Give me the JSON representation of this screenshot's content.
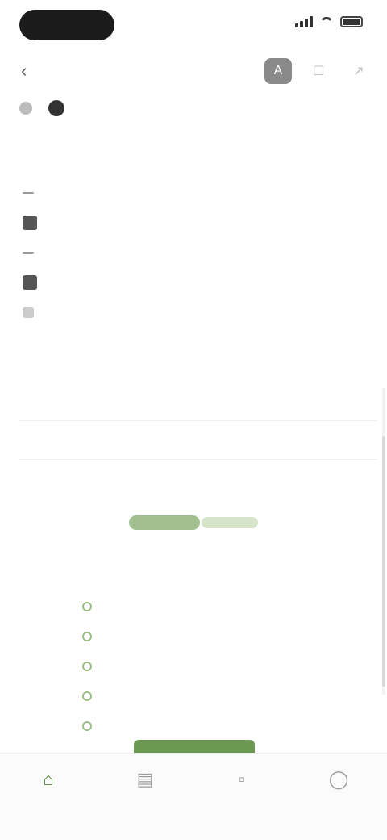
{
  "status_bar": {
    "time": ""
  },
  "toolbar": {
    "read_time": ""
  },
  "meta": {
    "author": "",
    "channel": ""
  },
  "content": {
    "section_label": "",
    "bullets": [
      "",
      "",
      "",
      "",
      ""
    ],
    "table_title": "",
    "table_headers": [
      "",
      "",
      "",
      ""
    ],
    "table_rows": [
      [
        "",
        "",
        "",
        ""
      ]
    ]
  },
  "callout": {
    "subtitle": "",
    "features": [
      "",
      "",
      "",
      "",
      ""
    ],
    "cta_label": ""
  },
  "tabs": [
    {
      "label": "",
      "icon": "home-icon",
      "active": true
    },
    {
      "label": "",
      "icon": "book-icon",
      "active": false
    },
    {
      "label": "",
      "icon": "bookmark-icon",
      "active": false
    },
    {
      "label": "",
      "icon": "profile-icon",
      "active": false
    }
  ],
  "colors": {
    "accent": "#6d9a52",
    "accent_soft": "#d6e5c9",
    "text": "#2b2b2b"
  }
}
